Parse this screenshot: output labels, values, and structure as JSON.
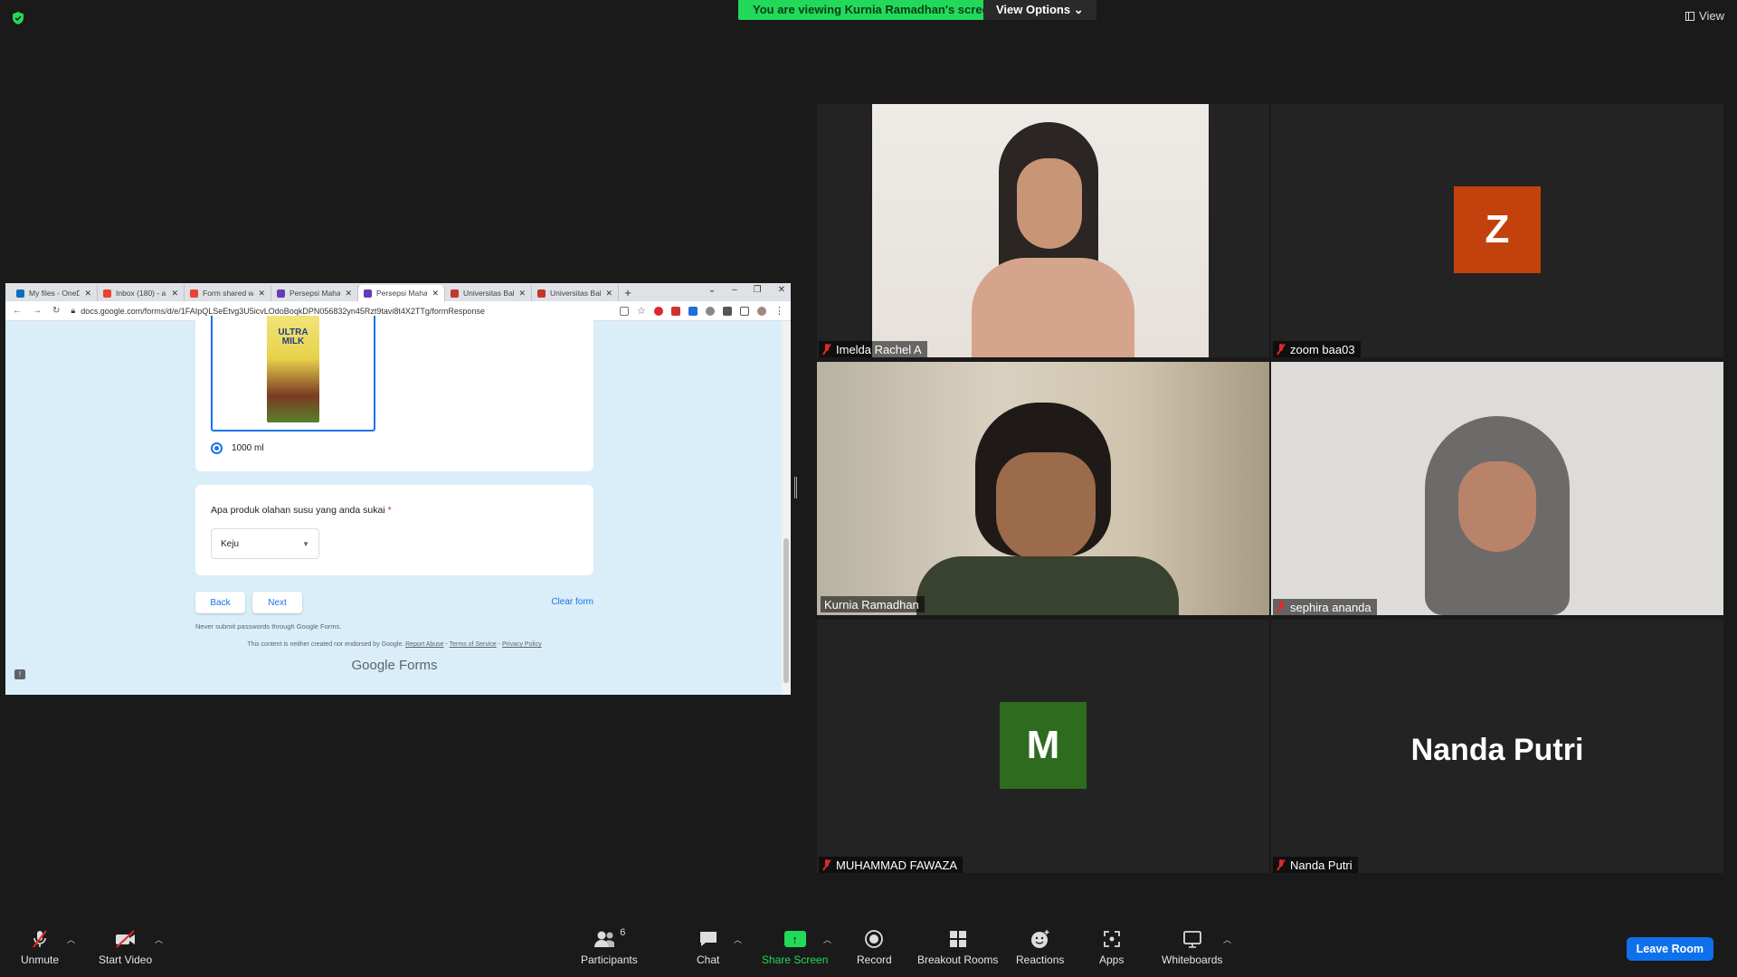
{
  "top_bar": {
    "banner": "You are viewing Kurnia Ramadhan's screen",
    "view_options": "View Options",
    "view": "View"
  },
  "browser": {
    "tabs": [
      {
        "label": "My files - OneDrive",
        "color": "#0f6cbd"
      },
      {
        "label": "Inbox (180) - a",
        "color": "#ea4335"
      },
      {
        "label": "Form shared w",
        "color": "#ea4335"
      },
      {
        "label": "Persepsi Maha",
        "color": "#673ab7"
      },
      {
        "label": "Persepsi Maha",
        "color": "#673ab7"
      },
      {
        "label": "Universitas Bal",
        "color": "#c0392b"
      },
      {
        "label": "Universitas Bal",
        "color": "#c0392b"
      }
    ],
    "active_tab_index": 4,
    "url": "docs.google.com/forms/d/e/1FAIpQLSeEtvg3U5icvLOdoBoqkDPN056832yn45Rzt9tavi8t4X2TTg/formResponse"
  },
  "form": {
    "product_image_text": "ULTRA MILK",
    "option_label": "1000 ml",
    "question": "Apa produk olahan susu yang anda sukai",
    "required_mark": "*",
    "select_value": "Keju",
    "back_label": "Back",
    "next_label": "Next",
    "clear_label": "Clear form",
    "never_submit": "Never submit passwords through Google Forms.",
    "footer_text": "This content is neither created nor endorsed by Google.",
    "report_abuse": "Report Abuse",
    "terms": "Terms of Service",
    "privacy": "Privacy Policy",
    "brand": "Google Forms"
  },
  "participants_tiles": [
    {
      "name": "Imelda Rachel A",
      "muted": true
    },
    {
      "name": "zoom baa03",
      "muted": true,
      "avatar_letter": "Z",
      "avatar_color": "#c2410c"
    },
    {
      "name": "Kurnia Ramadhan",
      "muted": false,
      "active_speaker": true
    },
    {
      "name": "sephira ananda",
      "muted": true
    },
    {
      "name": "MUHAMMAD FAWAZA",
      "muted": true,
      "avatar_letter": "M",
      "avatar_color": "#2e6b1f"
    },
    {
      "name": "Nanda Putri",
      "muted": true,
      "big_name": "Nanda Putri"
    }
  ],
  "toolbar": {
    "unmute": "Unmute",
    "start_video": "Start Video",
    "participants": "Participants",
    "participants_count": "6",
    "chat": "Chat",
    "share_screen": "Share Screen",
    "record": "Record",
    "breakout_rooms": "Breakout Rooms",
    "reactions": "Reactions",
    "apps": "Apps",
    "whiteboards": "Whiteboards",
    "leave_room": "Leave Room"
  }
}
